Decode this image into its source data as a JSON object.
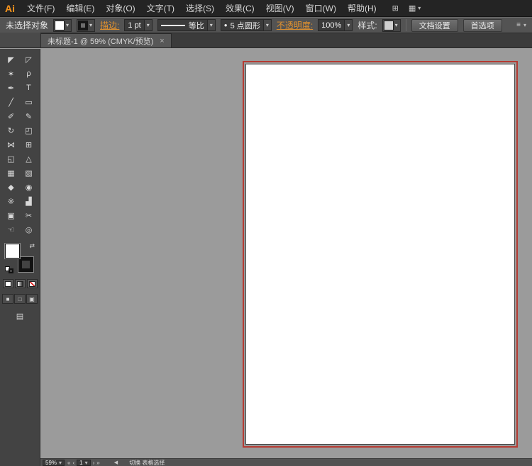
{
  "app": {
    "logo_text": "Ai"
  },
  "colors": {
    "accent_orange": "#e0912f",
    "bleed_red": "#b63b33",
    "canvas_gray": "#9b9b9b",
    "ui_dark": "#242424",
    "ui_mid": "#535353"
  },
  "menubar": {
    "items": [
      "文件(F)",
      "编辑(E)",
      "对象(O)",
      "文字(T)",
      "选择(S)",
      "效果(C)",
      "视图(V)",
      "窗口(W)",
      "帮助(H)"
    ]
  },
  "control_bar": {
    "no_selection": "未选择对象",
    "stroke_link": "描边:",
    "stroke_width_value": "1 pt",
    "width_profile_label": "等比",
    "brush_label": "5 点圆形",
    "opacity_link": "不透明度:",
    "opacity_value": "100%",
    "style_label": "样式:",
    "doc_setup_button": "文档设置",
    "preferences_button": "首选项"
  },
  "document_tab": {
    "title": "未标题-1 @ 59% (CMYK/预览)"
  },
  "toolbar": {
    "tools": [
      {
        "name": "selection-tool",
        "glyph": "◤"
      },
      {
        "name": "direct-selection-tool",
        "glyph": "◸"
      },
      {
        "name": "magic-wand-tool",
        "glyph": "✶"
      },
      {
        "name": "lasso-tool",
        "glyph": "ρ"
      },
      {
        "name": "pen-tool",
        "glyph": "✒"
      },
      {
        "name": "type-tool",
        "glyph": "T"
      },
      {
        "name": "line-tool",
        "glyph": "╱"
      },
      {
        "name": "rectangle-tool",
        "glyph": "▭"
      },
      {
        "name": "paintbrush-tool",
        "glyph": "✐"
      },
      {
        "name": "pencil-tool",
        "glyph": "✎"
      },
      {
        "name": "rotate-tool",
        "glyph": "↻"
      },
      {
        "name": "scale-tool",
        "glyph": "◰"
      },
      {
        "name": "width-tool",
        "glyph": "⋈"
      },
      {
        "name": "free-transform-tool",
        "glyph": "⊞"
      },
      {
        "name": "shape-builder-tool",
        "glyph": "◱"
      },
      {
        "name": "perspective-grid-tool",
        "glyph": "△"
      },
      {
        "name": "mesh-tool",
        "glyph": "▦"
      },
      {
        "name": "gradient-tool",
        "glyph": "▧"
      },
      {
        "name": "eyedropper-tool",
        "glyph": "◆"
      },
      {
        "name": "blend-tool",
        "glyph": "◉"
      },
      {
        "name": "symbol-sprayer-tool",
        "glyph": "※"
      },
      {
        "name": "column-graph-tool",
        "glyph": "▟"
      },
      {
        "name": "artboard-tool",
        "glyph": "▣"
      },
      {
        "name": "slice-tool",
        "glyph": "✂"
      },
      {
        "name": "hand-tool",
        "glyph": "☜"
      },
      {
        "name": "zoom-tool",
        "glyph": "◎"
      }
    ]
  },
  "status_bar": {
    "zoom_value": "59%",
    "artboard_value": "1",
    "hint_text": "切换 表格选择"
  },
  "icons": {
    "caret_down": "▾",
    "swap": "⇄",
    "arrange_documents": "⊞",
    "workspace": "▦",
    "panel_menu": "≡",
    "brush_dot": "●",
    "close_tab": "×",
    "screen_mode": "▤",
    "mode_normal": "■",
    "mode_behind": "□",
    "mode_inside": "▣",
    "nav_first": "«",
    "nav_prev": "‹",
    "nav_next": "›",
    "nav_last": "»",
    "scroll_left": "◀"
  }
}
